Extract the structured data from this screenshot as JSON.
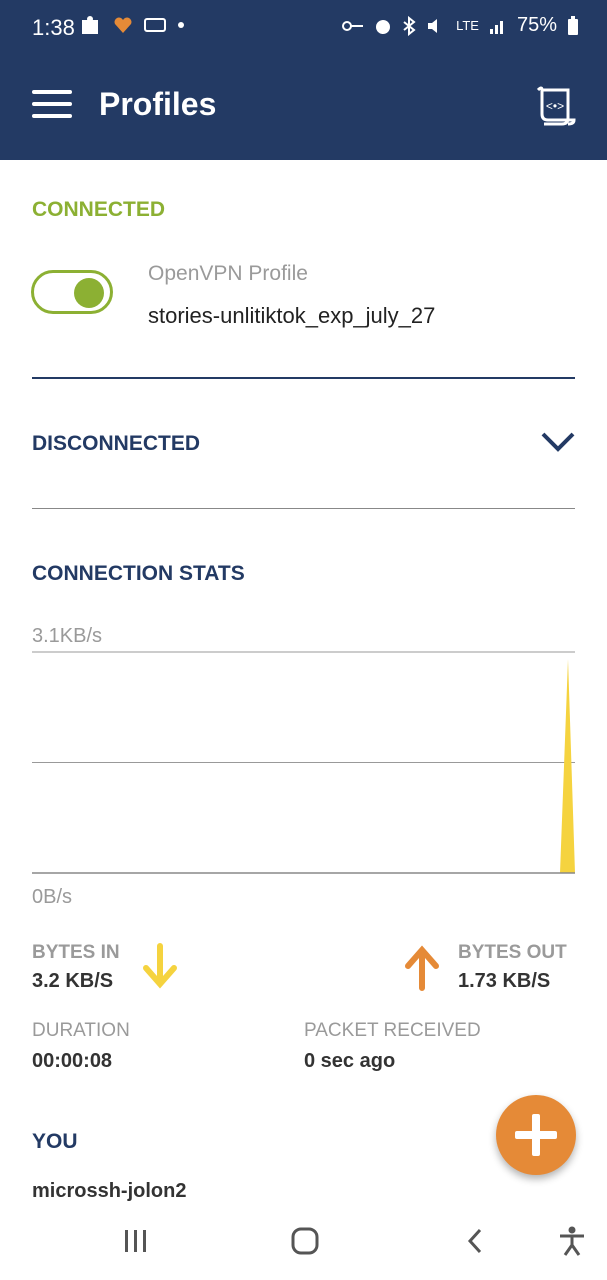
{
  "status_bar": {
    "time": "1:38",
    "battery": "75%",
    "network": "LTE"
  },
  "app_bar": {
    "title": "Profiles"
  },
  "connected_section": {
    "label": "CONNECTED",
    "profile_type": "OpenVPN Profile",
    "profile_name": "stories-unlitiktok_exp_july_27",
    "toggle_on": true
  },
  "disconnected_section": {
    "label": "DISCONNECTED"
  },
  "stats": {
    "label": "CONNECTION STATS",
    "chart_data": {
      "type": "area",
      "ytop_label": "3.1KB/s",
      "ybottom_label": "0B/s",
      "ylim": [
        0,
        3.1
      ],
      "series": [
        {
          "values": [
            0,
            0,
            0,
            0,
            0,
            0,
            0,
            0,
            0,
            0,
            0,
            0,
            0,
            0,
            0,
            0,
            0,
            0,
            0,
            0,
            3.0
          ]
        }
      ],
      "colors": {
        "bytes_in": "#f5d33f"
      }
    },
    "bytes_in_label": "BYTES IN",
    "bytes_in_value": "3.2 KB/S",
    "bytes_out_label": "BYTES OUT",
    "bytes_out_value": "1.73 KB/S",
    "duration_label": "DURATION",
    "duration_value": "00:00:08",
    "packet_label": "PACKET RECEIVED",
    "packet_value": "0 sec ago"
  },
  "you_section": {
    "label": "YOU",
    "value": "microssh-jolon2"
  },
  "colors": {
    "primary": "#233a64",
    "connected": "#8cb033",
    "accent": "#e58a37",
    "bytes_in": "#f5d33f",
    "bytes_out": "#e58a37"
  }
}
